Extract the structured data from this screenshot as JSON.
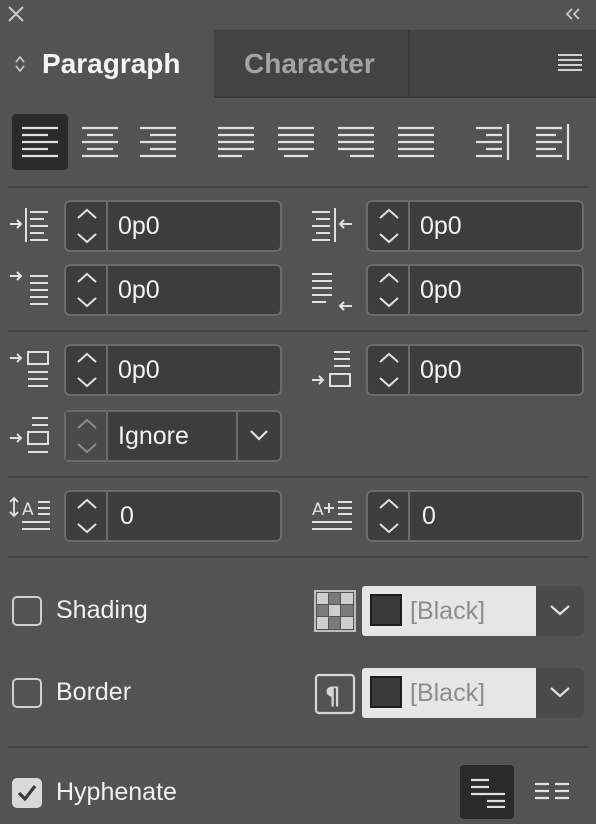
{
  "tabs": {
    "paragraph": "Paragraph",
    "character": "Character"
  },
  "icons": {
    "close": "close-icon",
    "collapse": "double-chevron-left-icon",
    "menu": "hamburger-menu-icon",
    "tab_arrows": "up-down-arrows-icon"
  },
  "alignment": {
    "buttons": [
      "align-left",
      "align-center",
      "align-right",
      "justify-last-left",
      "justify-last-center",
      "justify-last-right",
      "justify-all",
      "align-towards-spine",
      "align-away-from-spine"
    ],
    "selected": "align-left"
  },
  "fields": {
    "left_indent": "0p0",
    "right_indent": "0p0",
    "first_line_indent": "0p0",
    "last_line_right_indent": "0p0",
    "space_before": "0p0",
    "space_after": "0p0",
    "align_to_grid": "Ignore",
    "drop_cap_lines": "0",
    "drop_cap_chars": "0"
  },
  "shading": {
    "label": "Shading",
    "checked": false,
    "color": "[Black]"
  },
  "border": {
    "label": "Border",
    "checked": false,
    "color": "[Black]"
  },
  "hyphenate": {
    "label": "Hyphenate",
    "checked": true
  },
  "colors": {
    "panel": "#535353",
    "tabbar": "#434343",
    "field": "#3d3d3d",
    "selected": "#2a2a2a"
  }
}
